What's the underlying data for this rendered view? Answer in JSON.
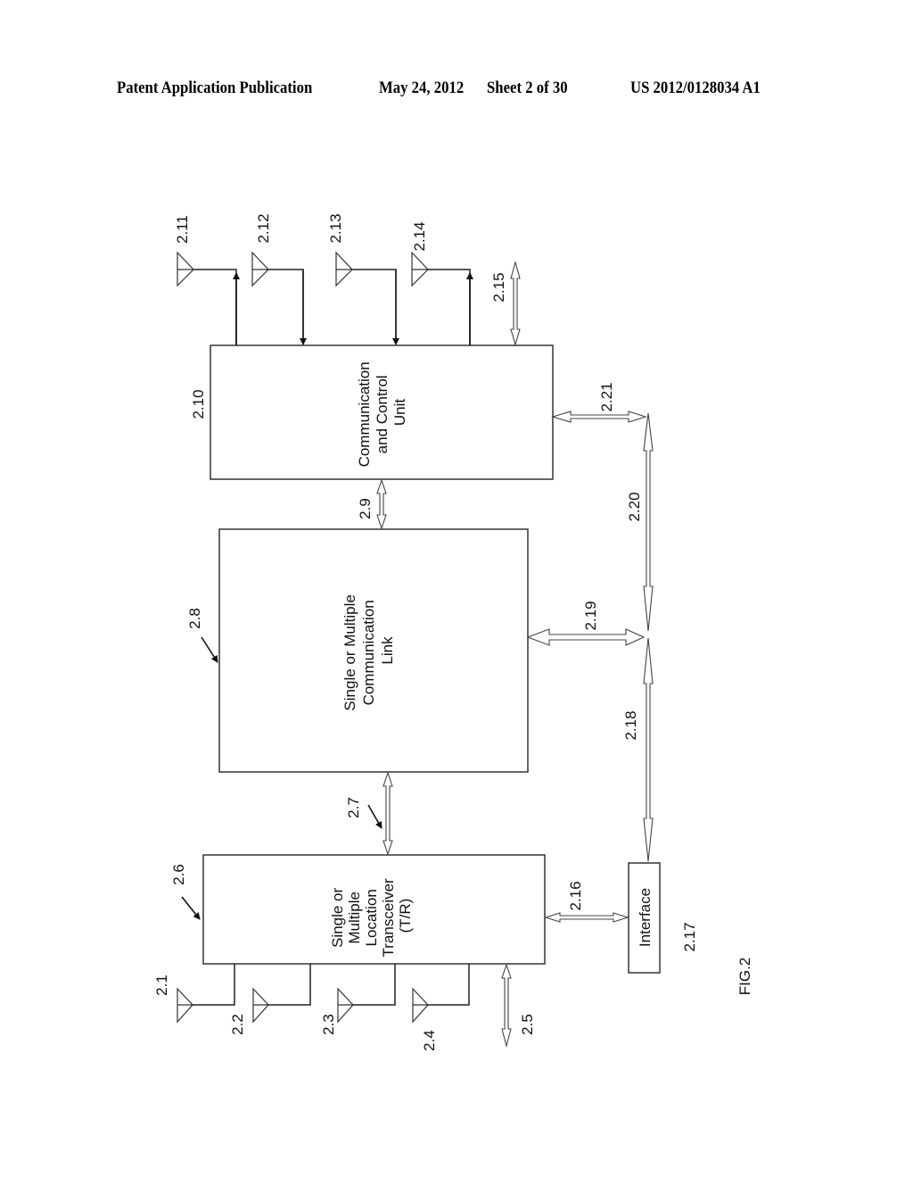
{
  "header": {
    "left": "Patent Application Publication",
    "date": "May 24, 2012",
    "sheet": "Sheet 2 of 30",
    "number": "US 2012/0128034 A1"
  },
  "figure": {
    "caption": "FIG.2",
    "blocks": {
      "comm_control": {
        "ref": "2.10",
        "lines": [
          "Communication",
          "and Control",
          "Unit"
        ]
      },
      "comm_link": {
        "ref": "2.8",
        "lines": [
          "Single or Multiple",
          "Communication",
          "Link"
        ]
      },
      "transceiver": {
        "ref": "2.6",
        "lines": [
          "Single or",
          "Multiple",
          "Location",
          "Transceiver",
          "(T/R)"
        ]
      },
      "interface": {
        "ref": "2.17",
        "lines": [
          "Interface"
        ]
      }
    },
    "refs": {
      "r2_1": "2.1",
      "r2_2": "2.2",
      "r2_3": "2.3",
      "r2_4": "2.4",
      "r2_5": "2.5",
      "r2_7": "2.7",
      "r2_9": "2.9",
      "r2_11": "2.11",
      "r2_12": "2.12",
      "r2_13": "2.13",
      "r2_14": "2.14",
      "r2_15": "2.15",
      "r2_16": "2.16",
      "r2_18": "2.18",
      "r2_19": "2.19",
      "r2_20": "2.20",
      "r2_21": "2.21"
    }
  }
}
